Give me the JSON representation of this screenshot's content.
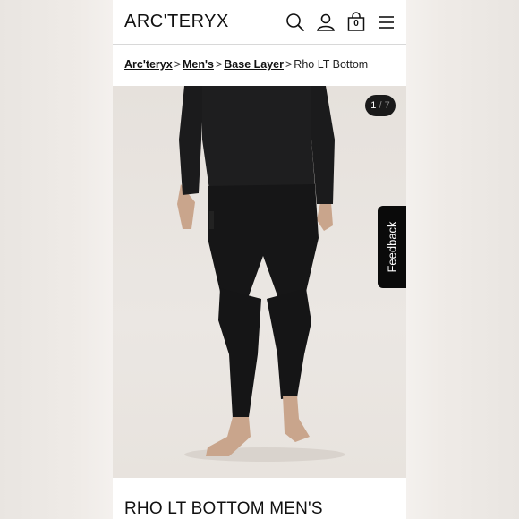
{
  "brand": {
    "logo_text": "ARC'TERYX"
  },
  "header": {
    "icons": [
      "search-icon",
      "account-icon",
      "cart-icon",
      "menu-icon"
    ],
    "cart_count": "0"
  },
  "breadcrumb": {
    "items": [
      "Arc'teryx",
      "Men's",
      "Base Layer"
    ],
    "current": "Rho LT Bottom",
    "separator": ">"
  },
  "gallery": {
    "current": "1",
    "divider": "/",
    "total": "7"
  },
  "feedback": {
    "label": "Feedback"
  },
  "product": {
    "title": "RHO LT BOTTOM MEN'S"
  },
  "colors": {
    "dark": "#111111",
    "badge": "#1a1a1a"
  }
}
